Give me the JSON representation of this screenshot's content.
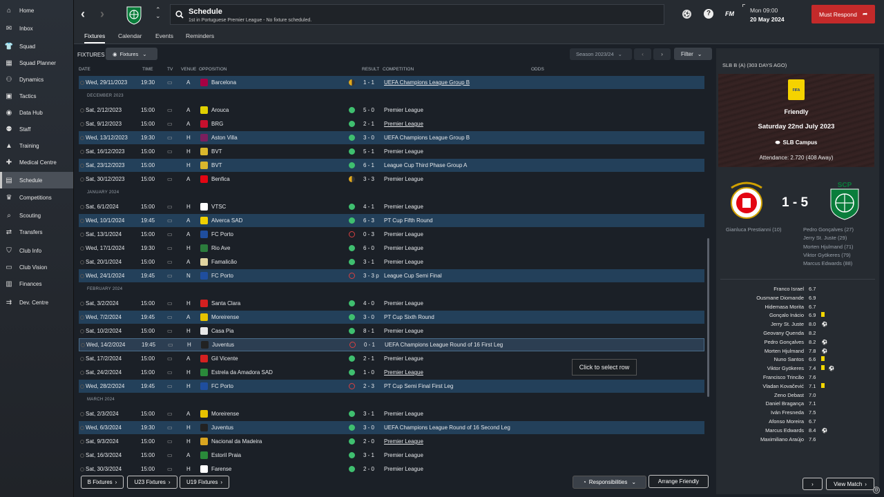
{
  "sidebar": [
    {
      "label": "Home",
      "icon": "home-icon",
      "glyph": "⌂"
    },
    {
      "label": "Inbox",
      "icon": "inbox-icon",
      "glyph": "✉"
    },
    {
      "label": "Squad",
      "icon": "shirt-icon",
      "glyph": "👕"
    },
    {
      "label": "Squad Planner",
      "icon": "planner-icon",
      "glyph": "▦"
    },
    {
      "label": "Dynamics",
      "icon": "dynamics-icon",
      "glyph": "⚇"
    },
    {
      "label": "Tactics",
      "icon": "tactics-icon",
      "glyph": "▣"
    },
    {
      "label": "Data Hub",
      "icon": "data-hub-icon",
      "glyph": "◉"
    },
    {
      "label": "Staff",
      "icon": "staff-icon",
      "glyph": "⚉"
    },
    {
      "label": "Training",
      "icon": "training-icon",
      "glyph": "▲"
    },
    {
      "label": "Medical Centre",
      "icon": "medical-icon",
      "glyph": "✚"
    },
    {
      "label": "Schedule",
      "icon": "calendar-icon",
      "glyph": "▤",
      "active": true
    },
    {
      "label": "Competitions",
      "icon": "trophy-icon",
      "glyph": "♛"
    },
    {
      "label": "Scouting",
      "icon": "scouting-icon",
      "glyph": "⌕"
    },
    {
      "label": "Transfers",
      "icon": "transfers-icon",
      "glyph": "⇄"
    },
    {
      "label": "Club Info",
      "icon": "shield-icon",
      "glyph": "⛉"
    },
    {
      "label": "Club Vision",
      "icon": "vision-icon",
      "glyph": "▭"
    },
    {
      "label": "Finances",
      "icon": "finances-icon",
      "glyph": "▥"
    },
    {
      "label": "Dev. Centre",
      "icon": "dev-centre-icon",
      "glyph": "⇉"
    }
  ],
  "topbar": {
    "title": "Schedule",
    "subtitle": "1st in Portuguese Premier League - No fixture scheduled.",
    "time": "Mon 09:00",
    "date": "20 May 2024",
    "must_respond": "Must Respond",
    "fm": "FM"
  },
  "tabs": [
    "Fixtures",
    "Calendar",
    "Events",
    "Reminders"
  ],
  "fixtures_bar": {
    "label": "FIXTURES",
    "filter": "Fixtures",
    "season": "Season 2023/24",
    "filter_btn": "Filter"
  },
  "columns": {
    "date": "DATE",
    "time": "TIME",
    "tv": "TV",
    "venue": "VENUE",
    "opposition": "OPPOSITION",
    "result": "RESULT",
    "competition": "COMPETITION",
    "odds": "ODDS"
  },
  "rows": [
    {
      "type": "match",
      "date": "Wed, 29/11/2023",
      "time": "19:30",
      "tv": true,
      "venue": "A",
      "opp": "Barcelona",
      "badge": "#a50044",
      "dot": "#e0a81c",
      "half": true,
      "res": "1 - 1",
      "comp": "UEFA Champions League Group B",
      "u": true,
      "alt": true
    },
    {
      "type": "month",
      "label": "DECEMBER 2023"
    },
    {
      "type": "match",
      "date": "Sat, 2/12/2023",
      "time": "15:00",
      "tv": true,
      "venue": "A",
      "opp": "Arouca",
      "badge": "#e0d000",
      "dot": "#3fbf6f",
      "res": "5 - 0",
      "comp": "Premier League"
    },
    {
      "type": "match",
      "date": "Sat, 9/12/2023",
      "time": "15:00",
      "tv": true,
      "venue": "A",
      "opp": "BRG",
      "badge": "#c8102e",
      "dot": "#3fbf6f",
      "res": "2 - 1",
      "comp": "Premier League",
      "u": true
    },
    {
      "type": "match",
      "date": "Wed, 13/12/2023",
      "time": "19:30",
      "tv": true,
      "venue": "H",
      "opp": "Aston Villa",
      "badge": "#7b1f5e",
      "dot": "#3fbf6f",
      "res": "3 - 0",
      "comp": "UEFA Champions League Group B",
      "alt": true
    },
    {
      "type": "match",
      "date": "Sat, 16/12/2023",
      "time": "15:00",
      "tv": true,
      "venue": "H",
      "opp": "BVT",
      "badge": "#d9b72c",
      "dot": "#3fbf6f",
      "res": "5 - 1",
      "comp": "Premier League"
    },
    {
      "type": "match",
      "date": "Sat, 23/12/2023",
      "time": "15:00",
      "tv": false,
      "venue": "H",
      "opp": "BVT",
      "badge": "#d9b72c",
      "dot": "#3fbf6f",
      "res": "6 - 1",
      "comp": "League Cup Third Phase Group A",
      "alt": true
    },
    {
      "type": "match",
      "date": "Sat, 30/12/2023",
      "time": "15:00",
      "tv": true,
      "venue": "A",
      "opp": "Benfica",
      "badge": "#e30613",
      "dot": "#e0a81c",
      "half": true,
      "res": "3 - 3",
      "comp": "Premier League"
    },
    {
      "type": "month",
      "label": "JANUARY 2024"
    },
    {
      "type": "match",
      "date": "Sat, 6/1/2024",
      "time": "15:00",
      "tv": true,
      "venue": "H",
      "opp": "VTSC",
      "badge": "#ffffff",
      "dot": "#3fbf6f",
      "res": "4 - 1",
      "comp": "Premier League"
    },
    {
      "type": "match",
      "date": "Wed, 10/1/2024",
      "time": "19:45",
      "tv": true,
      "venue": "A",
      "opp": "Alverca SAD",
      "badge": "#f0d000",
      "dot": "#3fbf6f",
      "res": "6 - 3",
      "comp": "PT Cup Fifth Round",
      "alt": true
    },
    {
      "type": "match",
      "date": "Sat, 13/1/2024",
      "time": "15:00",
      "tv": true,
      "venue": "A",
      "opp": "FC Porto",
      "badge": "#1f4e9e",
      "dot": "#d94040",
      "ring": true,
      "res": "0 - 3",
      "comp": "Premier League"
    },
    {
      "type": "match",
      "date": "Wed, 17/1/2024",
      "time": "19:30",
      "tv": true,
      "venue": "H",
      "opp": "Rio Ave",
      "badge": "#2b7c3c",
      "dot": "#3fbf6f",
      "res": "6 - 0",
      "comp": "Premier League"
    },
    {
      "type": "match",
      "date": "Sat, 20/1/2024",
      "time": "15:00",
      "tv": true,
      "venue": "A",
      "opp": "Famalicão",
      "badge": "#e0d4a0",
      "dot": "#3fbf6f",
      "res": "3 - 1",
      "comp": "Premier League"
    },
    {
      "type": "match",
      "date": "Wed, 24/1/2024",
      "time": "19:45",
      "tv": true,
      "venue": "N",
      "opp": "FC Porto",
      "badge": "#1f4e9e",
      "dot": "#d94040",
      "ring": true,
      "res": "3 - 3 p",
      "comp": "League Cup Semi Final",
      "alt": true
    },
    {
      "type": "month",
      "label": "FEBRUARY 2024"
    },
    {
      "type": "match",
      "date": "Sat, 3/2/2024",
      "time": "15:00",
      "tv": true,
      "venue": "H",
      "opp": "Santa Clara",
      "badge": "#d42020",
      "dot": "#3fbf6f",
      "res": "4 - 0",
      "comp": "Premier League"
    },
    {
      "type": "match",
      "date": "Wed, 7/2/2024",
      "time": "19:45",
      "tv": true,
      "venue": "A",
      "opp": "Moreirense",
      "badge": "#e6c200",
      "dot": "#3fbf6f",
      "res": "3 - 0",
      "comp": "PT Cup Sixth Round",
      "alt": true
    },
    {
      "type": "match",
      "date": "Sat, 10/2/2024",
      "time": "15:00",
      "tv": true,
      "venue": "H",
      "opp": "Casa Pia",
      "badge": "#e8e8e8",
      "dot": "#3fbf6f",
      "res": "8 - 1",
      "comp": "Premier League"
    },
    {
      "type": "match",
      "date": "Wed, 14/2/2024",
      "time": "19:45",
      "tv": true,
      "venue": "H",
      "opp": "Juventus",
      "badge": "#222222",
      "dot": "#d94040",
      "ring": true,
      "res": "0 - 1",
      "comp": "UEFA Champions League Round of 16  First Leg",
      "hl": true
    },
    {
      "type": "match",
      "date": "Sat, 17/2/2024",
      "time": "15:00",
      "tv": true,
      "venue": "A",
      "opp": "Gil Vicente",
      "badge": "#d42020",
      "dot": "#3fbf6f",
      "res": "2 - 1",
      "comp": "Premier League"
    },
    {
      "type": "match",
      "date": "Sat, 24/2/2024",
      "time": "15:00",
      "tv": true,
      "venue": "H",
      "opp": "Estrela da Amadora SAD",
      "badge": "#2a8a3a",
      "dot": "#3fbf6f",
      "res": "1 - 0",
      "comp": "Premier League",
      "u": true
    },
    {
      "type": "match",
      "date": "Wed, 28/2/2024",
      "time": "19:45",
      "tv": true,
      "venue": "H",
      "opp": "FC Porto",
      "badge": "#1f4e9e",
      "dot": "#d94040",
      "ring": true,
      "res": "2 - 3",
      "comp": "PT Cup Semi Final First Leg",
      "alt": true
    },
    {
      "type": "month",
      "label": "MARCH 2024"
    },
    {
      "type": "match",
      "date": "Sat, 2/3/2024",
      "time": "15:00",
      "tv": true,
      "venue": "A",
      "opp": "Moreirense",
      "badge": "#e6c200",
      "dot": "#3fbf6f",
      "res": "3 - 1",
      "comp": "Premier League"
    },
    {
      "type": "match",
      "date": "Wed, 6/3/2024",
      "time": "19:30",
      "tv": true,
      "venue": "H",
      "opp": "Juventus",
      "badge": "#222222",
      "dot": "#3fbf6f",
      "res": "3 - 0",
      "comp": "UEFA Champions League Round of 16  Second Leg",
      "alt": true
    },
    {
      "type": "match",
      "date": "Sat, 9/3/2024",
      "time": "15:00",
      "tv": true,
      "venue": "H",
      "opp": "Nacional da Madeira",
      "badge": "#d9a520",
      "dot": "#3fbf6f",
      "res": "2 - 0",
      "comp": "Premier League",
      "u": true
    },
    {
      "type": "match",
      "date": "Sat, 16/3/2024",
      "time": "15:00",
      "tv": true,
      "venue": "A",
      "opp": "Estoril Praia",
      "badge": "#2a8a3a",
      "dot": "#3fbf6f",
      "res": "3 - 1",
      "comp": "Premier League"
    },
    {
      "type": "match",
      "date": "Sat, 30/3/2024",
      "time": "15:00",
      "tv": true,
      "venue": "H",
      "opp": "Farense",
      "badge": "#ffffff",
      "dot": "#3fbf6f",
      "res": "2 - 0",
      "comp": "Premier League"
    }
  ],
  "bottom": {
    "b": "B Fixtures",
    "u23": "U23 Fixtures",
    "u19": "U19 Fixtures",
    "resp": "Responsibilities",
    "arrange": "Arrange Friendly"
  },
  "tooltip": "Click to select row",
  "match_panel": {
    "header": "SLB B (A) (303 DAYS AGO)",
    "type": "Friendly",
    "date": "Saturday 22nd July 2023",
    "venue": "SLB Campus",
    "attendance": "Attendance: 2.720 (408 Away)",
    "score": "1 - 5",
    "home_scorers": [
      "Gianluca Prestianni (10)"
    ],
    "away_scorers": [
      "Pedro Gonçalves (27)",
      "Jerry St. Juste (29)",
      "Morten Hjulmand (71)",
      "Viktor Gyökeres (79)",
      "Marcus Edwards (88)"
    ],
    "view_match": "View Match"
  },
  "ratings": [
    {
      "name": "Franco Israel",
      "r": "6.7"
    },
    {
      "name": "Ousmane Diomande",
      "r": "6.9"
    },
    {
      "name": "Hidemasa Morita",
      "r": "6.7"
    },
    {
      "name": "Gonçalo Inácio",
      "r": "6.9",
      "yc": true
    },
    {
      "name": "Jerry St. Juste",
      "r": "8.0",
      "goal": true
    },
    {
      "name": "Geovany Quenda",
      "r": "8.2"
    },
    {
      "name": "Pedro Gonçalves",
      "r": "8.2",
      "goal": true
    },
    {
      "name": "Morten Hjulmand",
      "r": "7.8",
      "goal": true
    },
    {
      "name": "Nuno Santos",
      "r": "6.6",
      "yc": true
    },
    {
      "name": "Viktor Gyökeres",
      "r": "7.4",
      "yc": true,
      "goal": true
    },
    {
      "name": "Francisco Trincão",
      "r": "7.6"
    },
    {
      "name": "Vladan Kovačević",
      "r": "7.1",
      "yc": true
    },
    {
      "name": "Zeno Debast",
      "r": "7.0"
    },
    {
      "name": "Daniel Bragança",
      "r": "7.1"
    },
    {
      "name": "Iván Fresneda",
      "r": "7.5"
    },
    {
      "name": "Afonso Moreira",
      "r": "6.7"
    },
    {
      "name": "Marcus Edwards",
      "r": "8.4",
      "goal": true
    },
    {
      "name": "Maximiliano Araújo",
      "r": "7.6"
    }
  ]
}
